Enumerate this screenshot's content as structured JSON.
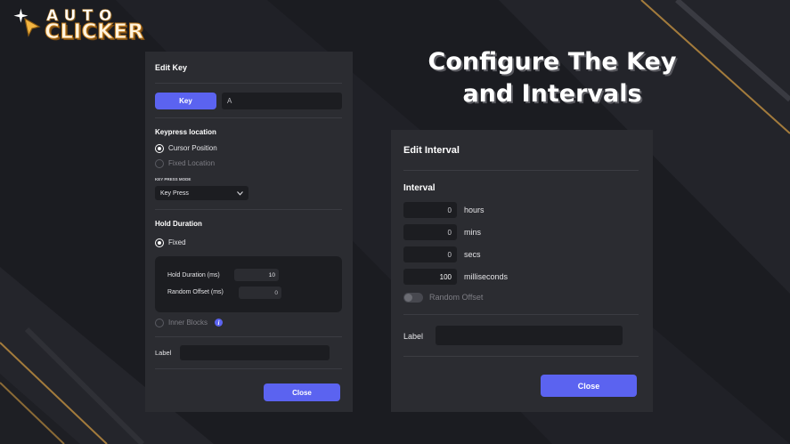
{
  "brand": {
    "line1": "AUTO",
    "line2": "CLICKER"
  },
  "headline": {
    "line1": "Configure The Key",
    "line2": "and Intervals"
  },
  "edit_key": {
    "title": "Edit Key",
    "key_button": "Key",
    "key_value": "A",
    "keypress_location_heading": "Keypress location",
    "options": {
      "cursor_position": "Cursor Position",
      "fixed_location": "Fixed Location"
    },
    "key_press_mode_label": "KEY PRESS MODE",
    "key_press_mode_value": "Key Press",
    "hold_duration_heading": "Hold Duration",
    "fixed_option": "Fixed",
    "hold_duration_label": "Hold Duration (ms)",
    "hold_duration_value": "10",
    "random_offset_label": "Random Offset (ms)",
    "random_offset_value": "0",
    "inner_blocks_label": "Inner Blocks",
    "label_label": "Label",
    "label_value": "",
    "close_button": "Close"
  },
  "edit_interval": {
    "title": "Edit Interval",
    "interval_heading": "Interval",
    "rows": [
      {
        "value": "0",
        "unit": "hours"
      },
      {
        "value": "0",
        "unit": "mins"
      },
      {
        "value": "0",
        "unit": "secs"
      },
      {
        "value": "100",
        "unit": "milliseconds"
      }
    ],
    "random_offset_label": "Random Offset",
    "label_label": "Label",
    "label_value": "",
    "close_button": "Close"
  },
  "colors": {
    "accent": "#5b63f0",
    "panel": "#2b2c31",
    "field": "#1c1d21",
    "gold": "#c9964a"
  }
}
